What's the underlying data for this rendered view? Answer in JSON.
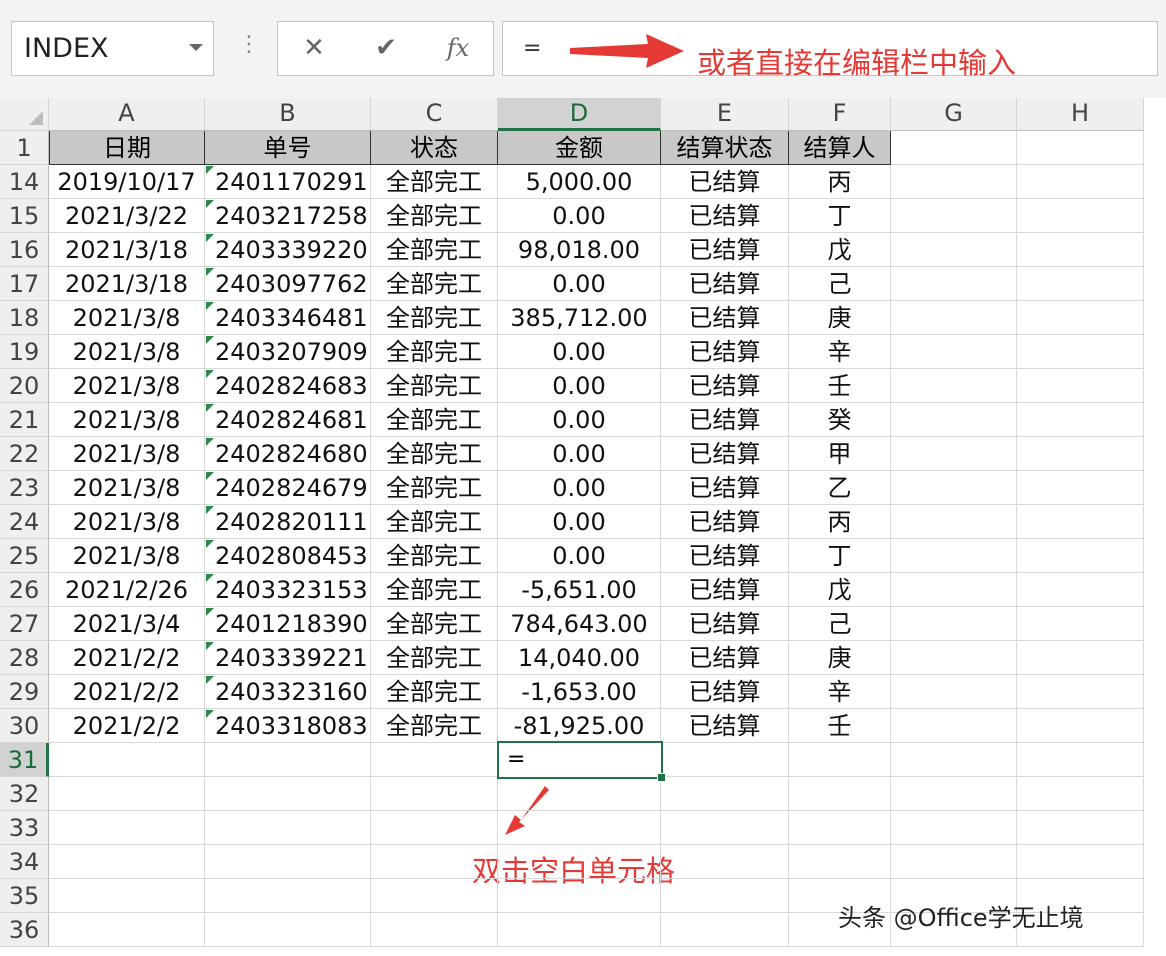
{
  "formula_bar": {
    "name_box": "INDEX",
    "cancel_icon": "✕",
    "enter_icon": "✔",
    "fx_icon": "fx",
    "formula": "="
  },
  "annotations": {
    "formula_hint": "或者直接在编辑栏中输入",
    "cell_hint": "双击空白单元格",
    "arrow_color": "#e53935"
  },
  "columns": [
    "A",
    "B",
    "C",
    "D",
    "E",
    "F",
    "G",
    "H"
  ],
  "selected_column": "D",
  "header_row": {
    "row_number": "1",
    "labels": [
      "日期",
      "单号",
      "状态",
      "金额",
      "结算状态",
      "结算人"
    ]
  },
  "rows": [
    {
      "n": "14",
      "date": "2019/10/17",
      "id": "2401170291",
      "status": "全部完工",
      "amount": "5,000.00",
      "settle": "已结算",
      "person": "丙"
    },
    {
      "n": "15",
      "date": "2021/3/22",
      "id": "2403217258",
      "status": "全部完工",
      "amount": "0.00",
      "settle": "已结算",
      "person": "丁"
    },
    {
      "n": "16",
      "date": "2021/3/18",
      "id": "2403339220",
      "status": "全部完工",
      "amount": "98,018.00",
      "settle": "已结算",
      "person": "戊"
    },
    {
      "n": "17",
      "date": "2021/3/18",
      "id": "2403097762",
      "status": "全部完工",
      "amount": "0.00",
      "settle": "已结算",
      "person": "己"
    },
    {
      "n": "18",
      "date": "2021/3/8",
      "id": "2403346481",
      "status": "全部完工",
      "amount": "385,712.00",
      "settle": "已结算",
      "person": "庚"
    },
    {
      "n": "19",
      "date": "2021/3/8",
      "id": "2403207909",
      "status": "全部完工",
      "amount": "0.00",
      "settle": "已结算",
      "person": "辛"
    },
    {
      "n": "20",
      "date": "2021/3/8",
      "id": "2402824683",
      "status": "全部完工",
      "amount": "0.00",
      "settle": "已结算",
      "person": "壬"
    },
    {
      "n": "21",
      "date": "2021/3/8",
      "id": "2402824681",
      "status": "全部完工",
      "amount": "0.00",
      "settle": "已结算",
      "person": "癸"
    },
    {
      "n": "22",
      "date": "2021/3/8",
      "id": "2402824680",
      "status": "全部完工",
      "amount": "0.00",
      "settle": "已结算",
      "person": "甲"
    },
    {
      "n": "23",
      "date": "2021/3/8",
      "id": "2402824679",
      "status": "全部完工",
      "amount": "0.00",
      "settle": "已结算",
      "person": "乙"
    },
    {
      "n": "24",
      "date": "2021/3/8",
      "id": "2402820111",
      "status": "全部完工",
      "amount": "0.00",
      "settle": "已结算",
      "person": "丙"
    },
    {
      "n": "25",
      "date": "2021/3/8",
      "id": "2402808453",
      "status": "全部完工",
      "amount": "0.00",
      "settle": "已结算",
      "person": "丁"
    },
    {
      "n": "26",
      "date": "2021/2/26",
      "id": "2403323153",
      "status": "全部完工",
      "amount": "-5,651.00",
      "settle": "已结算",
      "person": "戊"
    },
    {
      "n": "27",
      "date": "2021/3/4",
      "id": "2401218390",
      "status": "全部完工",
      "amount": "784,643.00",
      "settle": "已结算",
      "person": "己"
    },
    {
      "n": "28",
      "date": "2021/2/2",
      "id": "2403339221",
      "status": "全部完工",
      "amount": "14,040.00",
      "settle": "已结算",
      "person": "庚"
    },
    {
      "n": "29",
      "date": "2021/2/2",
      "id": "2403323160",
      "status": "全部完工",
      "amount": "-1,653.00",
      "settle": "已结算",
      "person": "辛"
    },
    {
      "n": "30",
      "date": "2021/2/2",
      "id": "2403318083",
      "status": "全部完工",
      "amount": "-81,925.00",
      "settle": "已结算",
      "person": "壬"
    }
  ],
  "empty_rows": [
    "31",
    "32",
    "33",
    "34",
    "35",
    "36"
  ],
  "active_cell": {
    "row": "31",
    "column": "D",
    "content": "="
  },
  "watermark": "头条 @Office学无止境",
  "colors": {
    "accent": "#217346",
    "header_fill": "#c8c8c8"
  }
}
